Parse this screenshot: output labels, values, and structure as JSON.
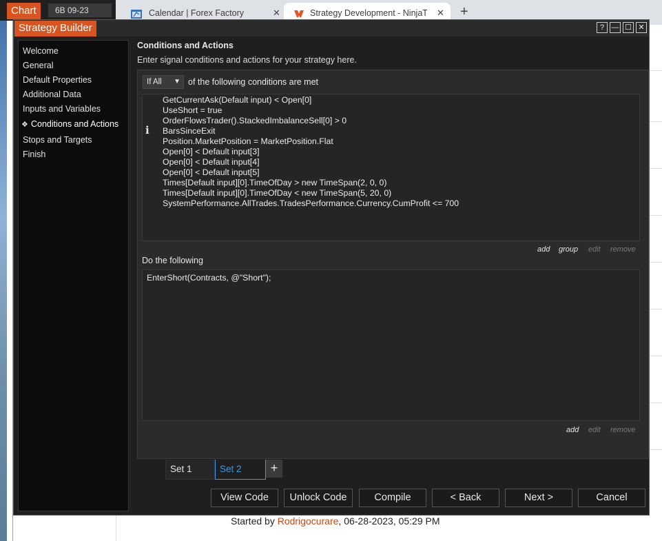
{
  "chart": {
    "tab_label": "Chart",
    "instrument": "6B 09-23"
  },
  "browser": {
    "tabs": [
      {
        "label": "Calendar | Forex Factory",
        "close": "✕"
      },
      {
        "label": "Strategy Development - NinjaTra",
        "close": "✕"
      }
    ],
    "new_tab": "+"
  },
  "forum": {
    "prefix": "Started by ",
    "author": "Rodrigocurare",
    "suffix": ", 06-28-2023, 05:29 PM"
  },
  "dialog": {
    "title": "Strategy Builder",
    "window_buttons": [
      "?",
      "—",
      "☐",
      "✕"
    ]
  },
  "sidebar": {
    "items": [
      {
        "label": "Welcome"
      },
      {
        "label": "General"
      },
      {
        "label": "Default Properties"
      },
      {
        "label": "Additional Data"
      },
      {
        "label": "Inputs and Variables"
      },
      {
        "label": "Conditions and Actions",
        "marker": "❖"
      },
      {
        "label": "Stops and Targets"
      },
      {
        "label": "Finish"
      }
    ]
  },
  "main": {
    "title": "Conditions and Actions",
    "description": "Enter signal conditions and actions for your strategy here.",
    "match_select": "If All",
    "match_label": "of the following conditions are met",
    "info_glyph": "i",
    "conditions": [
      "GetCurrentAsk(Default input) < Open[0]",
      "UseShort = true",
      "OrderFlowsTrader().StackedImbalanceSell[0] > 0",
      "BarsSinceExit",
      "Position.MarketPosition = MarketPosition.Flat",
      "Open[0] < Default input[3]",
      "Open[0] < Default input[4]",
      "Open[0] < Default input[5]",
      "Times[Default input][0].TimeOfDay > new TimeSpan(2, 0, 0)",
      "Times[Default input][0].TimeOfDay < new TimeSpan(5, 20, 0)",
      "SystemPerformance.AllTrades.TradesPerformance.Currency.CumProfit <= 700"
    ],
    "condition_actions": {
      "add": "add",
      "group": "group",
      "edit": "edit",
      "remove": "remove"
    },
    "do_label": "Do the following",
    "actions": [
      "EnterShort(Contracts, @\"Short\");"
    ],
    "action_actions": {
      "add": "add",
      "edit": "edit",
      "remove": "remove"
    }
  },
  "sets": {
    "tabs": [
      "Set 1",
      "Set 2"
    ],
    "active": "Set 2",
    "add": "+"
  },
  "footer": {
    "view_code": "View Code",
    "unlock_code": "Unlock Code",
    "compile": "Compile",
    "back": "< Back",
    "next": "Next >",
    "cancel": "Cancel"
  },
  "colors": {
    "accent_orange": "#d9541e",
    "active_tab_blue": "#3d9ae8",
    "dialog_bg": "#1f1f1f",
    "sidebar_bg": "#0c0c0c",
    "panel_bg": "#2b2b2b"
  }
}
